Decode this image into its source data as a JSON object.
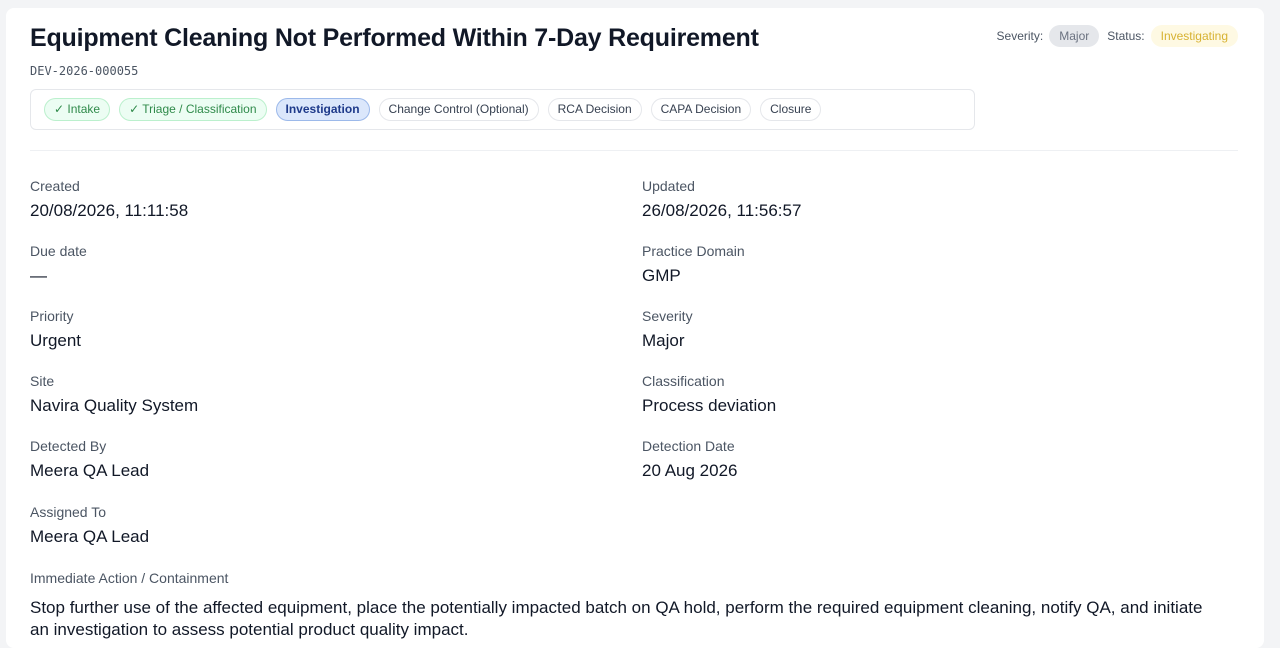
{
  "deviation": {
    "title": "Equipment Cleaning Not Performed Within 7-Day Requirement",
    "id": "DEV-2026-000055"
  },
  "header": {
    "severity_label": "Severity:",
    "severity_value": "Major",
    "status_label": "Status:",
    "status_value": "Investigating"
  },
  "workflow": {
    "steps": [
      {
        "label": "✓ Intake",
        "state": "done"
      },
      {
        "label": "✓ Triage / Classification",
        "state": "done"
      },
      {
        "label": "Investigation",
        "state": "active"
      },
      {
        "label": "Change Control (Optional)",
        "state": "pending"
      },
      {
        "label": "RCA Decision",
        "state": "pending"
      },
      {
        "label": "CAPA Decision",
        "state": "pending"
      },
      {
        "label": "Closure",
        "state": "pending"
      }
    ]
  },
  "details": {
    "created": {
      "label": "Created",
      "value": "20/08/2026, 11:11:58"
    },
    "updated": {
      "label": "Updated",
      "value": "26/08/2026, 11:56:57"
    },
    "due_date": {
      "label": "Due date",
      "value": "—"
    },
    "practice_domain": {
      "label": "Practice Domain",
      "value": "GMP"
    },
    "priority": {
      "label": "Priority",
      "value": "Urgent"
    },
    "severity": {
      "label": "Severity",
      "value": "Major"
    },
    "site": {
      "label": "Site",
      "value": "Navira Quality System"
    },
    "classification": {
      "label": "Classification",
      "value": "Process deviation"
    },
    "detected_by": {
      "label": "Detected By",
      "value": "Meera QA Lead"
    },
    "detection_date": {
      "label": "Detection Date",
      "value": "20 Aug 2026"
    },
    "assigned_to": {
      "label": "Assigned To",
      "value": "Meera QA Lead"
    }
  },
  "immediate_action": {
    "label": "Immediate Action / Containment",
    "value": "Stop further use of the affected equipment, place the potentially impacted batch on QA hold, perform the required equipment cleaning, notify QA, and initiate an investigation to assess potential product quality impact."
  }
}
